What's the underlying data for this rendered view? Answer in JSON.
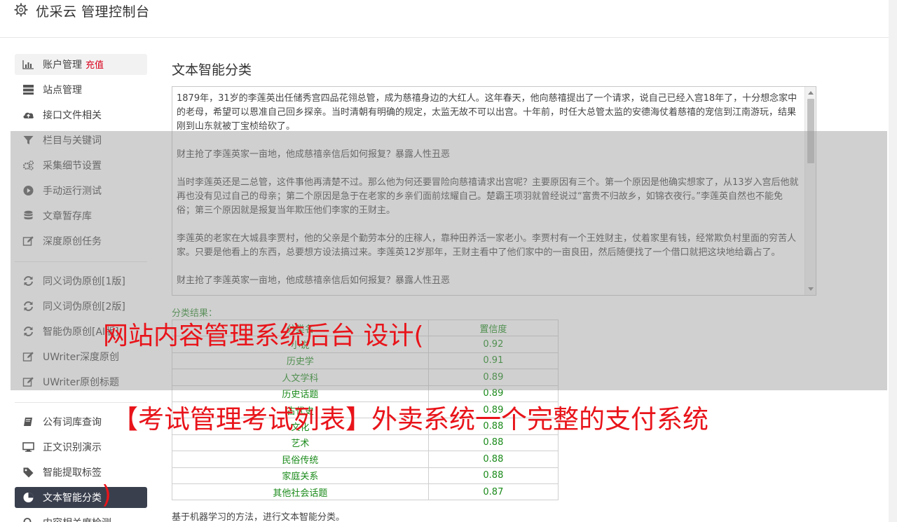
{
  "header": {
    "title": "优采云 管理控制台",
    "icon": "gear-icon"
  },
  "sidebar": {
    "items": [
      {
        "label": "账户管理",
        "extra": "充值",
        "icon": "bar-chart-icon"
      },
      {
        "label": "站点管理",
        "icon": "server-icon"
      },
      {
        "label": "接口文件相关",
        "icon": "cloud-upload-icon"
      },
      {
        "label": "栏目与关键词",
        "icon": "filter-icon"
      },
      {
        "label": "采集细节设置",
        "icon": "cogs-icon"
      },
      {
        "label": "手动运行测试",
        "icon": "play-circle-icon"
      },
      {
        "label": "文章暂存库",
        "icon": "database-icon"
      },
      {
        "label": "深度原创任务",
        "icon": "edit-icon"
      },
      {
        "label": "同义词伪原创[1版]",
        "icon": "refresh-icon"
      },
      {
        "label": "同义词伪原创[2版]",
        "icon": "refresh-icon"
      },
      {
        "label": "智能伪原创[AI版]",
        "icon": "refresh-icon"
      },
      {
        "label": "UWriter深度原创",
        "icon": "edit-icon"
      },
      {
        "label": "UWriter原创标题",
        "icon": "edit-icon"
      },
      {
        "label": "公有词库查询",
        "icon": "book-icon"
      },
      {
        "label": "正文识别演示",
        "icon": "monitor-icon"
      },
      {
        "label": "智能提取标签",
        "icon": "tag-icon"
      },
      {
        "label": "文本智能分类",
        "icon": "pie-chart-icon"
      },
      {
        "label": "内容相关度检测",
        "icon": "search-icon"
      }
    ]
  },
  "main": {
    "title": "文本智能分类",
    "text_paragraphs": [
      "1879年，31岁的李莲英出任储秀宫四品花翎总管，成为慈禧身边的大红人。这年春天，他向慈禧提出了一个请求，说自己已经入宫18年了，十分想念家中的老母，希望可以恩准自己回乡探亲。当时清朝有明确的规定，太监无故不可以出宫。十年前，时任大总管太监的安德海仗着慈禧的宠信到江南游玩，结果刚到山东就被丁宝桢给砍了。",
      "财主抢了李莲英家一亩地，他成慈禧亲信后如何报复？暴露人性丑恶",
      "当时李莲英还是二总管，这件事他再清楚不过。那么他为何还要冒险向慈禧请求出宫呢？主要原因有三个。第一个原因是他确实想家了，从13岁入宫后他就再也没有见过自己的母亲；第二个原因是急于在老家的乡亲们面前炫耀自己。楚霸王项羽就曾经说过“富贵不归故乡，如锦衣夜行。”李莲英自然也不能免俗；第三个原因就是报复当年欺压他们李家的王财主。",
      "李莲英的老家在大城县李贾村，他的父亲是个勤劳本分的庄稼人，靠种田养活一家老小。李贾村有一个王姓财主，仗着家里有钱，经常欺负村里面的穷苦人家。只要是他看上的东西，总要想方设法搞过来。李莲英12岁那年，王财主看中了他们家中的一亩良田，然后随便找了一个借口就把这块地给霸占了。",
      "财主抢了李莲英家一亩地，他成慈禧亲信后如何报复？暴露人性丑恶"
    ],
    "result_label": "分类结果：",
    "table": {
      "headers": [
        "分类名",
        "置信度"
      ],
      "rows": [
        [
          "小说",
          "0.92"
        ],
        [
          "历史学",
          "0.91"
        ],
        [
          "人文学科",
          "0.89"
        ],
        [
          "历史话题",
          "0.89"
        ],
        [
          "古代史",
          "0.89"
        ],
        [
          "文化",
          "0.88"
        ],
        [
          "艺术",
          "0.88"
        ],
        [
          "民俗传统",
          "0.88"
        ],
        [
          "家庭关系",
          "0.88"
        ],
        [
          "其他社会话题",
          "0.87"
        ]
      ]
    },
    "footnote": "基于机器学习的方法，进行文本智能分类。"
  },
  "overlay": {
    "line1": "网站内容管理系统后台 设计(",
    "line2": "【考试管理考试列表】外卖系统一个完整的支付系统",
    "line3": ")"
  },
  "colors": {
    "accent_red": "#d9001b",
    "active_nav": "#393f4d",
    "result_green": "#1a8a1a"
  }
}
